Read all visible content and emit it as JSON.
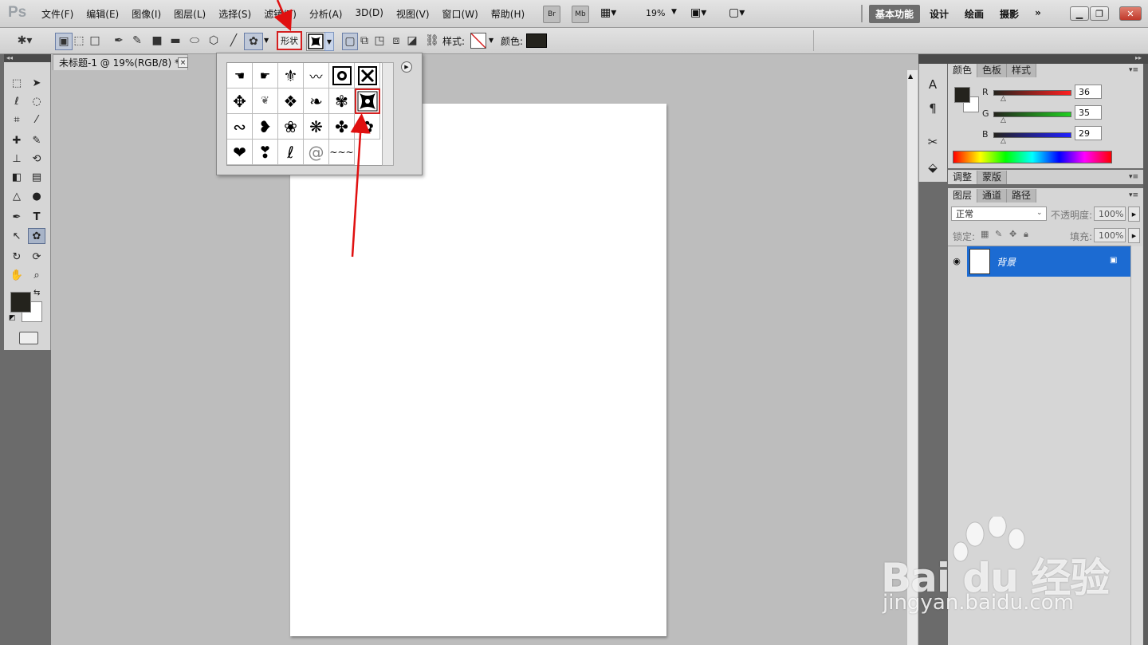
{
  "app": {
    "logo": "Ps"
  },
  "menu": [
    "文件(F)",
    "编辑(E)",
    "图像(I)",
    "图层(L)",
    "选择(S)",
    "滤镜(T)",
    "分析(A)",
    "3D(D)",
    "视图(V)",
    "窗口(W)",
    "帮助(H)"
  ],
  "menubar": {
    "bridge": "Br",
    "mini_bridge": "Mb",
    "zoom": "19%"
  },
  "workspaces": [
    "基本功能",
    "设计",
    "绘画",
    "摄影",
    "»"
  ],
  "options": {
    "shape_mode": "形状",
    "style_label": "样式:",
    "color_label": "颜色:",
    "color": "#24231d"
  },
  "document": {
    "tab_title": "未标题-1 @ 19%(RGB/8) *",
    "close": "×"
  },
  "color_panel": {
    "tabs": [
      "颜色",
      "色板",
      "样式"
    ],
    "channels": [
      {
        "label": "R",
        "value": "36"
      },
      {
        "label": "G",
        "value": "35"
      },
      {
        "label": "B",
        "value": "29"
      }
    ]
  },
  "adjust_panel": {
    "tabs": [
      "调整",
      "蒙版"
    ]
  },
  "layers_panel": {
    "tabs": [
      "图层",
      "通道",
      "路径"
    ],
    "blend_mode": "正常",
    "opacity_label": "不透明度:",
    "opacity": "100%",
    "lock_label": "锁定:",
    "fill_label": "填充:",
    "fill": "100%",
    "layer_name": "背景"
  },
  "colors": {
    "accent_red": "#d42020",
    "selection_blue": "#1c6bd2"
  },
  "watermark": {
    "brand": "Bai du 经验",
    "url": "jingyan.baidu.com"
  }
}
